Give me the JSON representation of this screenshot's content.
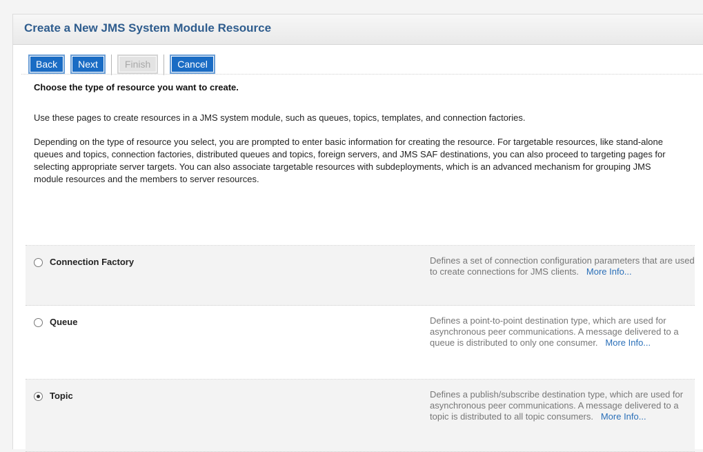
{
  "header": {
    "title": "Create a New JMS System Module Resource"
  },
  "toolbar": {
    "back_label": "Back",
    "next_label": "Next",
    "finish_label": "Finish",
    "cancel_label": "Cancel"
  },
  "intro": {
    "lead": "Choose the type of resource you want to create.",
    "paragraph1": "Use these pages to create resources in a JMS system module, such as queues, topics, templates, and connection factories.",
    "paragraph2": "Depending on the type of resource you select, you are prompted to enter basic information for creating the resource. For targetable resources, like stand-alone queues and topics, connection factories, distributed queues and topics, foreign servers, and JMS SAF destinations, you can also proceed to targeting pages for selecting appropriate server targets. You can also associate targetable resources with subdeployments, which is an advanced mechanism for grouping JMS module resources and the members to server resources."
  },
  "options": [
    {
      "label": "Connection Factory",
      "selected": false,
      "description": "Defines a set of connection configuration parameters that are used to create connections for JMS clients.",
      "more_info": "More Info..."
    },
    {
      "label": "Queue",
      "selected": false,
      "description": "Defines a point-to-point destination type, which are used for asynchronous peer communications. A message delivered to a queue is distributed to only one consumer.",
      "more_info": "More Info..."
    },
    {
      "label": "Topic",
      "selected": true,
      "description": "Defines a publish/subscribe destination type, which are used for asynchronous peer communications. A message delivered to a topic is distributed to all topic consumers.",
      "more_info": "More Info..."
    }
  ]
}
